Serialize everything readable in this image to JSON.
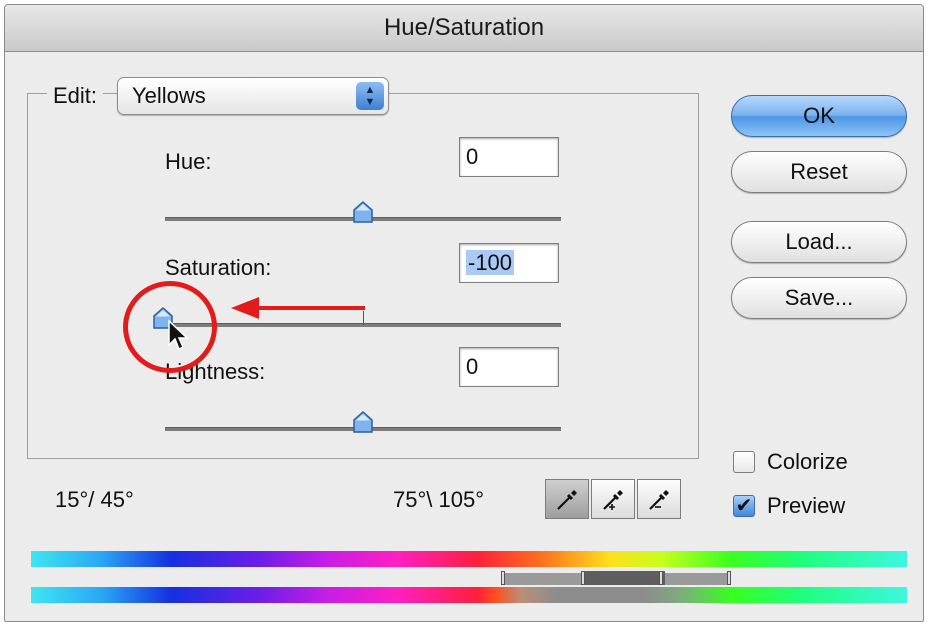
{
  "window": {
    "title": "Hue/Saturation"
  },
  "edit": {
    "label": "Edit:",
    "selected": "Yellows"
  },
  "controls": {
    "hue": {
      "label": "Hue:",
      "value": "0",
      "level": 0.5
    },
    "saturation": {
      "label": "Saturation:",
      "value": "-100",
      "level": 0.0
    },
    "lightness": {
      "label": "Lightness:",
      "value": "0",
      "level": 0.5
    }
  },
  "buttons": {
    "ok": "OK",
    "reset": "Reset",
    "load": "Load...",
    "save": "Save..."
  },
  "options": {
    "colorize": {
      "label": "Colorize",
      "checked": false
    },
    "preview": {
      "label": "Preview",
      "checked": true
    }
  },
  "range": {
    "left": "15°/ 45°",
    "right": "75°\\ 105°"
  },
  "icons": {
    "eyedropper": "eyedropper-icon",
    "eyedropper_plus": "eyedropper-plus-icon",
    "eyedropper_minus": "eyedropper-minus-icon",
    "select_arrows": "up-down-arrows-icon"
  },
  "colors": {
    "annotation": "#e21b1b",
    "accent": "#4d96e5"
  }
}
